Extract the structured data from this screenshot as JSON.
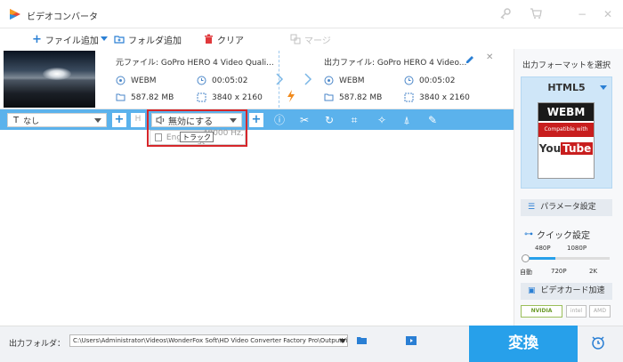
{
  "window": {
    "title": "ビデオコンバータ",
    "controls": [
      "key-icon",
      "cart-icon",
      "minimize-icon",
      "close-icon"
    ]
  },
  "toolbar": {
    "add_file": "ファイル追加",
    "add_folder": "フォルダ追加",
    "clear": "クリア",
    "merge": "マージ"
  },
  "file": {
    "source_name": "元ファイル: GoPro HERO 4 Video Quali...",
    "output_name": "出力ファイル: GoPro HERO 4 Video...",
    "source_format": "WEBM",
    "source_duration": "00:05:02",
    "source_size": "587.82 MB",
    "source_resolution": "3840 x 2160",
    "output_format": "WEBM",
    "output_duration": "00:05:02",
    "output_size": "587.82 MB",
    "output_resolution": "3840 x 2160"
  },
  "edit_bar": {
    "subtitle_value": "なし",
    "audio_value": "無効にする",
    "track_option": "Eng",
    "track_detail": ", 48000 Hz, st",
    "tooltip": "トラック"
  },
  "right_panel": {
    "select_format": "出力フォーマットを選択",
    "format_name": "HTML5",
    "format_card_top": "WEBM",
    "format_card_mid": "Compatible with",
    "format_card_you": "You",
    "format_card_tube": "Tube",
    "params_label": "パラメータ設定",
    "quick_label": "クイック設定",
    "quick_top_ticks": [
      "480P",
      "1080P"
    ],
    "quick_bottom_ticks": [
      "自動",
      "720P",
      "2K"
    ],
    "gpu_label": "ビデオカード加速",
    "vendor_nvidia": "NVIDIA",
    "vendor_intel": "intel",
    "vendor_amd": "AMD"
  },
  "bottom": {
    "output_folder_label": "出力フォルダ：",
    "output_path": "C:\\Users\\Administrator\\Videos\\WonderFox Soft\\HD Video Converter Factory Pro\\OutputVideo\\",
    "convert_label": "変換"
  },
  "colors": {
    "accent_blue": "#27a0ea",
    "edit_bar_blue": "#5bb2ec",
    "highlight_red": "#d6262a",
    "clear_icon_red": "#e0383b",
    "lightning_orange": "#f08a1d"
  }
}
